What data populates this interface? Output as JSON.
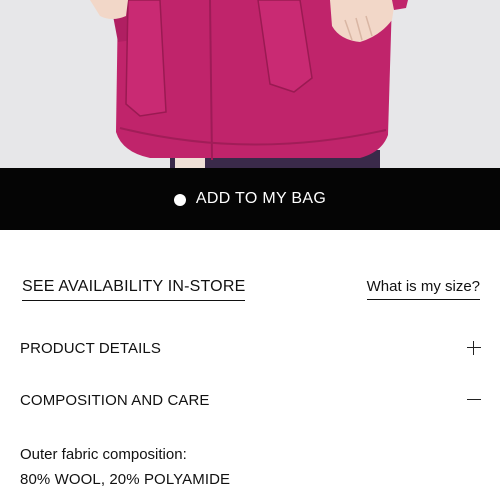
{
  "product_image": {
    "alt": "",
    "colors": {
      "coat": "#c0246b",
      "background": "#e6e6e8",
      "skin": "#f2d7c8"
    }
  },
  "bag_button": {
    "label": "ADD TO MY BAG",
    "icon": "dot-icon",
    "bg_color": "#050505",
    "text_color": "#ffffff"
  },
  "links": {
    "availability": "SEE AVAILABILITY IN-STORE",
    "size": "What is my size?"
  },
  "sections": [
    {
      "title": "PRODUCT DETAILS",
      "icon": "plus-icon",
      "expanded": false
    },
    {
      "title": "COMPOSITION AND CARE",
      "icon": "minus-icon",
      "expanded": true
    }
  ],
  "composition": {
    "label": "Outer fabric composition:",
    "value": "80% WOOL, 20% POLYAMIDE"
  }
}
